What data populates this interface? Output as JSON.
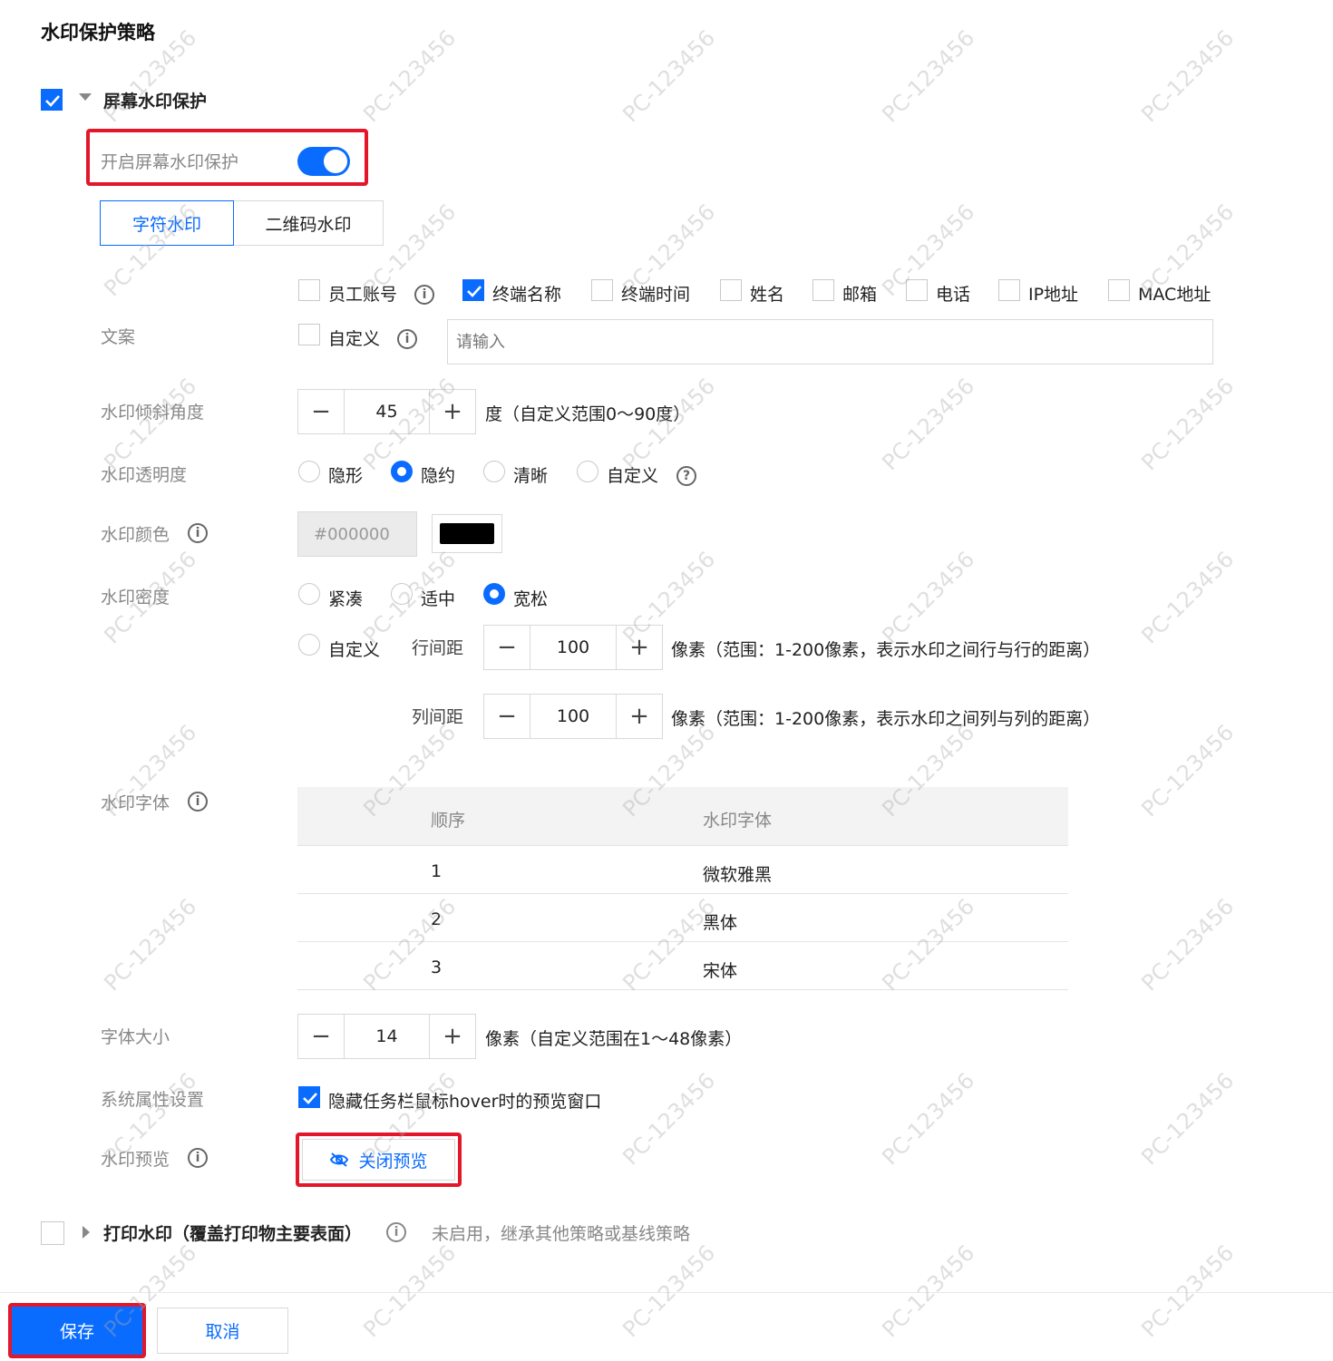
{
  "page_title": "水印保护策略",
  "screen_section": {
    "title": "屏幕水印保护",
    "checked": true,
    "expanded": true
  },
  "enable_toggle": {
    "label": "开启屏幕水印保护",
    "on": true
  },
  "tabs": [
    {
      "label": "字符水印",
      "active": true
    },
    {
      "label": "二维码水印",
      "active": false
    }
  ],
  "copy": {
    "label": "文案",
    "options": [
      {
        "label": "员工账号",
        "checked": false,
        "info": true
      },
      {
        "label": "终端名称",
        "checked": true
      },
      {
        "label": "终端时间",
        "checked": false
      },
      {
        "label": "姓名",
        "checked": false
      },
      {
        "label": "邮箱",
        "checked": false
      },
      {
        "label": "电话",
        "checked": false
      },
      {
        "label": "IP地址",
        "checked": false
      },
      {
        "label": "MAC地址",
        "checked": false
      }
    ],
    "custom_label": "自定义",
    "custom_checked": false,
    "custom_placeholder": "请输入"
  },
  "tilt": {
    "label": "水印倾斜角度",
    "value": "45",
    "hint": "度（自定义范围0～90度）"
  },
  "opacity": {
    "label": "水印透明度",
    "options": [
      {
        "label": "隐形"
      },
      {
        "label": "隐约"
      },
      {
        "label": "清晰"
      },
      {
        "label": "自定义"
      }
    ],
    "selected": "隐约"
  },
  "color": {
    "label": "水印颜色",
    "value": "#000000",
    "swatch": "#000000"
  },
  "density": {
    "label": "水印密度",
    "options": [
      {
        "label": "紧凑"
      },
      {
        "label": "适中"
      },
      {
        "label": "宽松"
      }
    ],
    "selected": "宽松",
    "custom_label": "自定义",
    "row_gap": {
      "label": "行间距",
      "value": "100",
      "hint": "像素（范围：1-200像素，表示水印之间行与行的距离）"
    },
    "col_gap": {
      "label": "列间距",
      "value": "100",
      "hint": "像素（范围：1-200像素，表示水印之间列与列的距离）"
    }
  },
  "font": {
    "label": "水印字体",
    "headers": {
      "order": "顺序",
      "font": "水印字体"
    },
    "rows": [
      {
        "order": "1",
        "font": "微软雅黑"
      },
      {
        "order": "2",
        "font": "黑体"
      },
      {
        "order": "3",
        "font": "宋体"
      }
    ]
  },
  "font_size": {
    "label": "字体大小",
    "value": "14",
    "hint": "像素（自定义范围在1～48像素）"
  },
  "system": {
    "label": "系统属性设置",
    "option": "隐藏任务栏鼠标hover时的预览窗口",
    "checked": true
  },
  "preview": {
    "label": "水印预览",
    "button": "关闭预览"
  },
  "print_section": {
    "title": "打印水印（覆盖打印物主要表面）",
    "note": "未启用，继承其他策略或基线策略",
    "checked": false
  },
  "footer": {
    "save": "保存",
    "cancel": "取消"
  },
  "watermark_text": "PC-123456",
  "colors": {
    "accent": "#0a6cff",
    "highlight": "#e3162a"
  }
}
